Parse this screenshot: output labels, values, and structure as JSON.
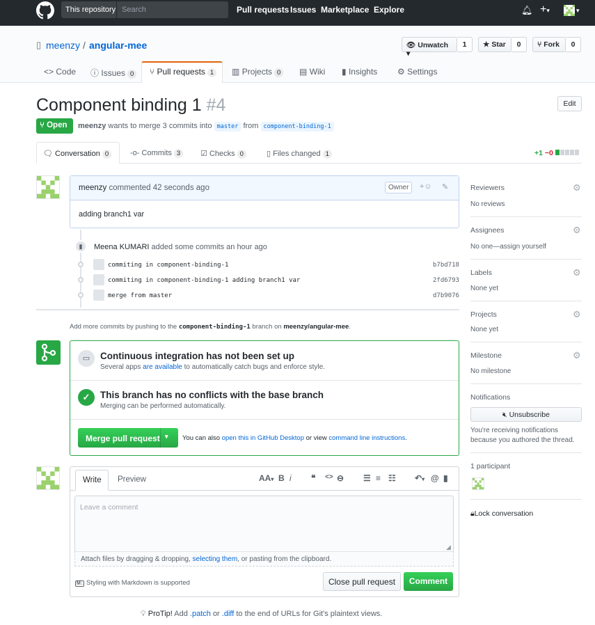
{
  "header": {
    "scope_label": "This repository",
    "search_placeholder": "Search",
    "nav": [
      "Pull requests",
      "Issues",
      "Marketplace",
      "Explore"
    ]
  },
  "repo": {
    "owner": "meenzy",
    "sep": "/",
    "name": "angular-mee",
    "unwatch_label": "Unwatch ▾",
    "watch_count": "1",
    "star_label": "Star",
    "star_count": "0",
    "fork_label": "Fork",
    "fork_count": "0",
    "tabs": [
      {
        "label": "Code",
        "count": ""
      },
      {
        "label": "Issues",
        "count": "0"
      },
      {
        "label": "Pull requests",
        "count": "1"
      },
      {
        "label": "Projects",
        "count": "0"
      },
      {
        "label": "Wiki",
        "count": ""
      },
      {
        "label": "Insights",
        "count": ""
      },
      {
        "label": "Settings",
        "count": ""
      }
    ]
  },
  "pr": {
    "title": "Component binding 1",
    "number": "#4",
    "edit_label": "Edit",
    "state": "Open",
    "author": "meenzy",
    "meta_mid": "wants to merge 3 commits into",
    "base": "master",
    "meta_from": "from",
    "head": "component-binding-1",
    "tabs": [
      {
        "label": "Conversation",
        "count": "0"
      },
      {
        "label": "Commits",
        "count": "3"
      },
      {
        "label": "Checks",
        "count": "0"
      },
      {
        "label": "Files changed",
        "count": "1"
      }
    ],
    "additions": "+1",
    "deletions": "−0"
  },
  "comment": {
    "author": "meenzy",
    "time_text": "commented 42 seconds ago",
    "owner_badge": "Owner",
    "body": "adding branch1 var"
  },
  "commits": {
    "author": "Meena KUMARI",
    "summary": "added some commits an hour ago",
    "items": [
      {
        "message": "commiting in component-binding-1",
        "sha": "b7bd718"
      },
      {
        "message": "commiting in component-binding-1 adding branch1 var",
        "sha": "2fd6793"
      },
      {
        "message": "merge from master",
        "sha": "d7b9076"
      }
    ]
  },
  "push_note": {
    "prefix": "Add more commits by pushing to the",
    "branch": "component-binding-1",
    "mid": "branch on",
    "repo": "meenzy/angular-mee",
    "suffix": "."
  },
  "merge": {
    "ci_title": "Continuous integration has not been set up",
    "ci_sub_a": "Several apps",
    "ci_sub_link": "are available",
    "ci_sub_b": "to automatically catch bugs and enforce style.",
    "noconf_title": "This branch has no conflicts with the base branch",
    "noconf_sub": "Merging can be performed automatically.",
    "button": "Merge pull request",
    "also_a": "You can also",
    "also_link1": "open this in GitHub Desktop",
    "also_b": "or view",
    "also_link2": "command line instructions",
    "also_c": "."
  },
  "form": {
    "write_tab": "Write",
    "preview_tab": "Preview",
    "placeholder": "Leave a comment",
    "attach_a": "Attach files by dragging & dropping,",
    "attach_link": "selecting them",
    "attach_b": ", or pasting from the clipboard.",
    "markdown_note": "Styling with Markdown is supported",
    "close_label": "Close pull request",
    "comment_label": "Comment"
  },
  "protip": {
    "label": "ProTip!",
    "text_a": "Add",
    "patch": ".patch",
    "or": "or",
    "diff": ".diff",
    "text_b": "to the end of URLs for Git's plaintext views."
  },
  "sidebar": {
    "reviewers_h": "Reviewers",
    "reviewers_v": "No reviews",
    "assignees_h": "Assignees",
    "assignees_v": "No one—assign yourself",
    "labels_h": "Labels",
    "labels_v": "None yet",
    "projects_h": "Projects",
    "projects_v": "None yet",
    "milestone_h": "Milestone",
    "milestone_v": "No milestone",
    "notifications_h": "Notifications",
    "unsubscribe": "Unsubscribe",
    "notif_note": "You're receiving notifications because you authored the thread.",
    "participants_h": "1 participant",
    "lock": "Lock conversation"
  },
  "colors": {
    "accent": "#0366d6",
    "success": "#28a745",
    "tab_highlight": "#e36209",
    "header_bg": "#24292e"
  }
}
